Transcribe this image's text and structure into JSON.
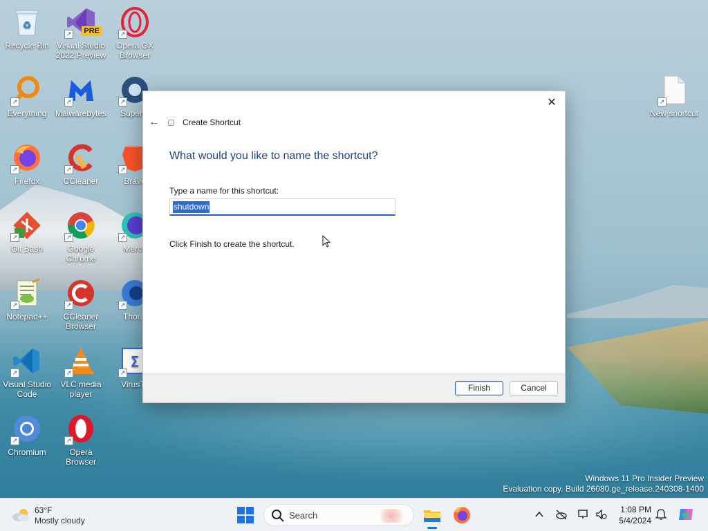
{
  "desktop": {
    "icons": [
      {
        "label": "Recycle Bin",
        "icon": "recycle-bin-icon"
      },
      {
        "label": "Visual Studio 2022 Preview",
        "icon": "visual-studio-preview-icon",
        "badge": "PRE"
      },
      {
        "label": "Opera GX Browser",
        "icon": "opera-gx-icon"
      },
      {
        "label": "Everything",
        "icon": "everything-search-icon"
      },
      {
        "label": "Malwarebytes",
        "icon": "malwarebytes-icon"
      },
      {
        "label": "Superm",
        "icon": "supermium-icon"
      },
      {
        "label": "Firefox",
        "icon": "firefox-icon"
      },
      {
        "label": "CCleaner",
        "icon": "ccleaner-icon"
      },
      {
        "label": "Brave",
        "icon": "brave-icon"
      },
      {
        "label": "Git Bash",
        "icon": "git-bash-icon"
      },
      {
        "label": "Google Chrome",
        "icon": "chrome-icon"
      },
      {
        "label": "Mercu",
        "icon": "mercury-icon"
      },
      {
        "label": "Notepad++",
        "icon": "notepadpp-icon"
      },
      {
        "label": "CCleaner Browser",
        "icon": "ccleaner-browser-icon"
      },
      {
        "label": "Thoriu",
        "icon": "thorium-icon"
      },
      {
        "label": "Visual Studio Code",
        "icon": "vscode-icon"
      },
      {
        "label": "VLC media player",
        "icon": "vlc-icon"
      },
      {
        "label": "VirusTo",
        "icon": "virustotal-icon"
      },
      {
        "label": "Chromium",
        "icon": "chromium-icon"
      },
      {
        "label": "Opera Browser",
        "icon": "opera-icon"
      },
      {
        "label": "New shortcut",
        "icon": "new-shortcut-icon"
      }
    ]
  },
  "dialog": {
    "title": "Create Shortcut",
    "heading": "What would you like to name the shortcut?",
    "name_label": "Type a name for this shortcut:",
    "name_value": "shutdown",
    "hint": "Click Finish to create the shortcut.",
    "finish_label": "Finish",
    "cancel_label": "Cancel",
    "close_glyph": "✕",
    "back_glyph": "←"
  },
  "watermark": {
    "line1": "Windows 11 Pro Insider Preview",
    "line2": "Evaluation copy. Build 26080.ge_release.240308-1400"
  },
  "taskbar": {
    "weather_temp": "63°F",
    "weather_condition": "Mostly cloudy",
    "search_placeholder": "Search",
    "time": "1:08 PM",
    "date": "5/4/2024",
    "accent": "#1a73e8"
  }
}
